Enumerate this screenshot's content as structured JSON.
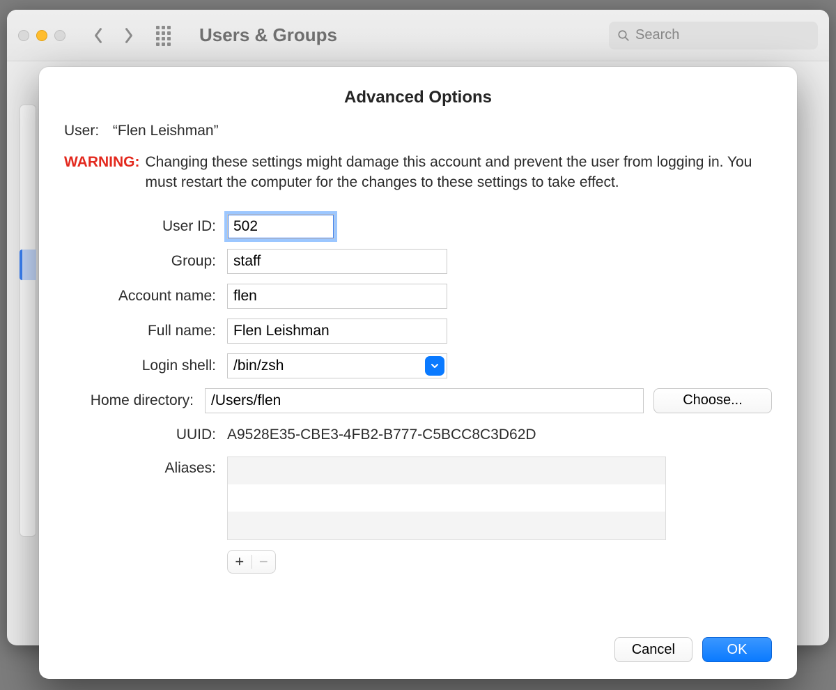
{
  "window": {
    "title": "Users & Groups",
    "search_placeholder": "Search"
  },
  "sheet": {
    "title": "Advanced Options",
    "user_label": "User:",
    "user_name": "“Flen Leishman”",
    "warning_label": "WARNING:",
    "warning_text": "Changing these settings might damage this account and prevent the user from logging in. You must restart the computer for the changes to these settings to take effect.",
    "fields": {
      "user_id": {
        "label": "User ID:",
        "value": "502"
      },
      "group": {
        "label": "Group:",
        "value": "staff"
      },
      "account_name": {
        "label": "Account name:",
        "value": "flen"
      },
      "full_name": {
        "label": "Full name:",
        "value": "Flen Leishman"
      },
      "login_shell": {
        "label": "Login shell:",
        "value": "/bin/zsh"
      },
      "home_dir": {
        "label": "Home directory:",
        "value": "/Users/flen"
      },
      "uuid": {
        "label": "UUID:",
        "value": "A9528E35-CBE3-4FB2-B777-C5BCC8C3D62D"
      },
      "aliases": {
        "label": "Aliases:"
      }
    },
    "choose_label": "Choose...",
    "add_label": "+",
    "remove_label": "−",
    "cancel_label": "Cancel",
    "ok_label": "OK"
  }
}
